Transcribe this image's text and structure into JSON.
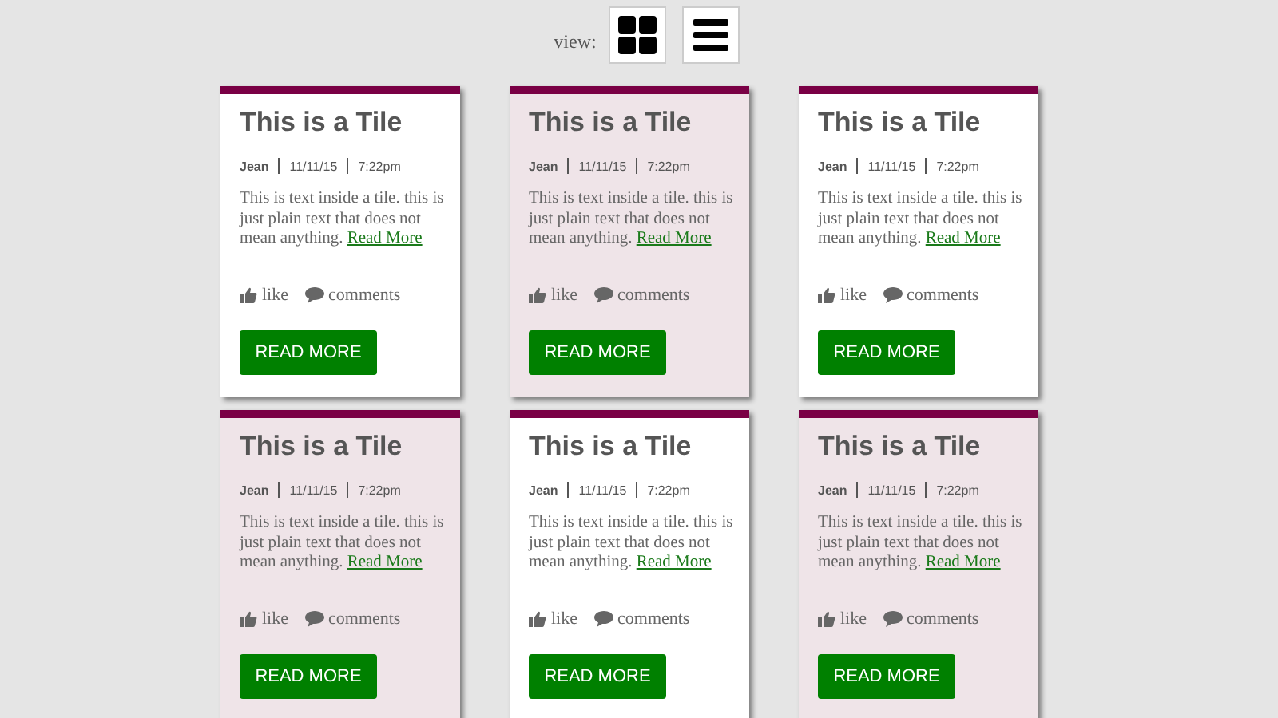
{
  "view_switcher": {
    "label": "view:"
  },
  "tiles": [
    {
      "title": "This is a Tile",
      "author": "Jean",
      "date": "11/11/15",
      "time": "7:22pm",
      "text": "This is text inside a tile. this is just plain text that does not mean anything.",
      "link": "Read More",
      "like": "like",
      "comments": "comments",
      "button": "READ MORE",
      "shaded": false
    },
    {
      "title": "This is a Tile",
      "author": "Jean",
      "date": "11/11/15",
      "time": "7:22pm",
      "text": "This is text inside a tile. this is just plain text that does not mean anything.",
      "link": "Read More",
      "like": "like",
      "comments": "comments",
      "button": "READ MORE",
      "shaded": true
    },
    {
      "title": "This is a Tile",
      "author": "Jean",
      "date": "11/11/15",
      "time": "7:22pm",
      "text": "This is text inside a tile. this is just plain text that does not mean anything.",
      "link": "Read More",
      "like": "like",
      "comments": "comments",
      "button": "READ MORE",
      "shaded": false
    },
    {
      "title": "This is a Tile",
      "author": "Jean",
      "date": "11/11/15",
      "time": "7:22pm",
      "text": "This is text inside a tile. this is just plain text that does not mean anything.",
      "link": "Read More",
      "like": "like",
      "comments": "comments",
      "button": "READ MORE",
      "shaded": true
    },
    {
      "title": "This is a Tile",
      "author": "Jean",
      "date": "11/11/15",
      "time": "7:22pm",
      "text": "This is text inside a tile. this is just plain text that does not mean anything.",
      "link": "Read More",
      "like": "like",
      "comments": "comments",
      "button": "READ MORE",
      "shaded": false
    },
    {
      "title": "This is a Tile",
      "author": "Jean",
      "date": "11/11/15",
      "time": "7:22pm",
      "text": "This is text inside a tile. this is just plain text that does not mean anything.",
      "link": "Read More",
      "like": "like",
      "comments": "comments",
      "button": "READ MORE",
      "shaded": true
    }
  ]
}
